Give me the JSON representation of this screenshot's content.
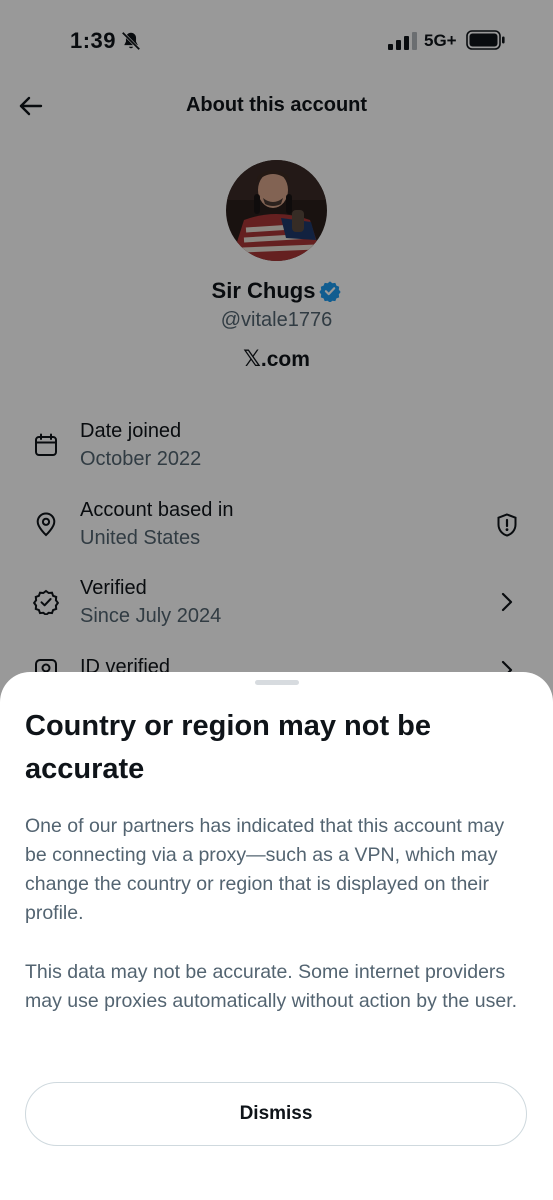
{
  "status_bar": {
    "time": "1:39",
    "network": "5G+",
    "icons": [
      "bell-slash-icon",
      "signal-icon",
      "battery-icon"
    ]
  },
  "header": {
    "title": "About this account",
    "back_icon": "arrow-left-icon"
  },
  "profile": {
    "display_name": "Sir Chugs",
    "handle": "@vitale1776",
    "site_domain": ".com",
    "site_logo_glyph": "𝕏",
    "verified_color": "#1d9bf0"
  },
  "info_rows": [
    {
      "icon": "calendar-icon",
      "label": "Date joined",
      "value": "October 2022"
    },
    {
      "icon": "location-pin-icon",
      "label": "Account based in",
      "value": "United States",
      "trailing_icon": "shield-alert-icon"
    },
    {
      "icon": "verified-check-icon",
      "label": "Verified",
      "value": "Since July 2024",
      "trailing_icon": "chevron-right-icon"
    },
    {
      "icon": "id-verified-icon",
      "label": "ID verified",
      "trailing_icon": "chevron-right-icon"
    }
  ],
  "sheet": {
    "title": "Country or region may not be accurate",
    "paragraph_1": "One of our partners has indicated that this account may be connecting via a proxy—such as a VPN, which may change the country or region that is displayed on their profile.",
    "paragraph_2": "This data may not be accurate. Some internet providers may use proxies automatically without action by the user.",
    "dismiss_label": "Dismiss"
  }
}
